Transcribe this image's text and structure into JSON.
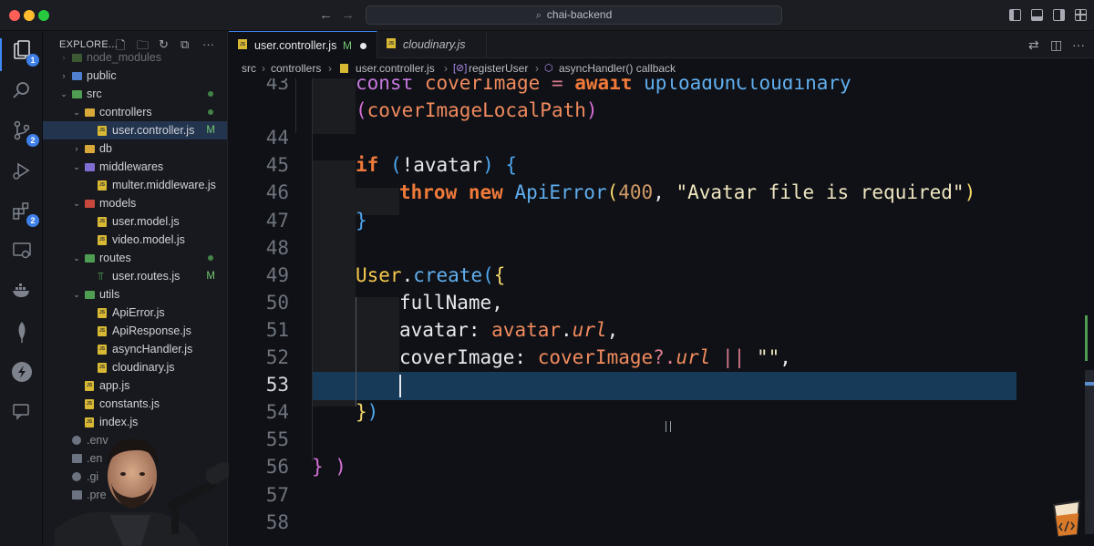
{
  "window": {
    "title": "chai-backend"
  },
  "activity_bar": {
    "explorer_badge": "1",
    "scm_badge": "2",
    "extensions_badge": "2"
  },
  "explorer": {
    "title": "EXPLORE...",
    "items": [
      {
        "label": "node_modules",
        "type": "folder",
        "depth": 1
      },
      {
        "label": "public",
        "type": "folder",
        "depth": 1
      },
      {
        "label": "src",
        "type": "folder-open",
        "depth": 1
      },
      {
        "label": "controllers",
        "type": "folder-open",
        "depth": 2
      },
      {
        "label": "user.controller.js",
        "type": "file",
        "depth": 3,
        "status": "M"
      },
      {
        "label": "db",
        "type": "folder",
        "depth": 2
      },
      {
        "label": "middlewares",
        "type": "folder-open",
        "depth": 2
      },
      {
        "label": "multer.middleware.js",
        "type": "file",
        "depth": 3
      },
      {
        "label": "models",
        "type": "folder-open",
        "depth": 2
      },
      {
        "label": "user.model.js",
        "type": "file",
        "depth": 3
      },
      {
        "label": "video.model.js",
        "type": "file",
        "depth": 3
      },
      {
        "label": "routes",
        "type": "folder-open",
        "depth": 2
      },
      {
        "label": "user.routes.js",
        "type": "file",
        "depth": 3,
        "status": "M"
      },
      {
        "label": "utils",
        "type": "folder-open",
        "depth": 2
      },
      {
        "label": "ApiError.js",
        "type": "file",
        "depth": 3
      },
      {
        "label": "ApiResponse.js",
        "type": "file",
        "depth": 3
      },
      {
        "label": "asyncHandler.js",
        "type": "file",
        "depth": 3
      },
      {
        "label": "cloudinary.js",
        "type": "file",
        "depth": 3
      },
      {
        "label": "app.js",
        "type": "file",
        "depth": 2
      },
      {
        "label": "constants.js",
        "type": "file",
        "depth": 2
      },
      {
        "label": "index.js",
        "type": "file",
        "depth": 2
      },
      {
        "label": ".env",
        "type": "config",
        "depth": 1
      },
      {
        "label": ".en",
        "type": "config",
        "depth": 1
      },
      {
        "label": ".gi",
        "type": "config",
        "depth": 1
      },
      {
        "label": ".pre",
        "type": "config",
        "depth": 1
      }
    ]
  },
  "tabs": [
    {
      "label": "user.controller.js",
      "status": "M",
      "dirty": true,
      "active": true
    },
    {
      "label": "cloudinary.js",
      "active": false
    }
  ],
  "breadcrumb": {
    "parts": [
      "src",
      "controllers",
      "user.controller.js",
      "registerUser",
      "asyncHandler() callback"
    ]
  },
  "editor": {
    "current_line": "53",
    "lines": [
      {
        "no": "43",
        "tokens": [
          [
            "kw2",
            "const "
          ],
          [
            "obj",
            "coverImage"
          ],
          [
            "op",
            " = "
          ],
          [
            "kw",
            "await "
          ],
          [
            "fn",
            "uploadOnCloudinary"
          ]
        ]
      },
      {
        "no": "",
        "tokens": [
          [
            "brace-p",
            "("
          ],
          [
            "obj",
            "coverImageLocalPath"
          ],
          [
            "brace-p",
            ")"
          ]
        ]
      },
      {
        "no": "44",
        "tokens": []
      },
      {
        "no": "45",
        "tokens": [
          [
            "kw",
            "if "
          ],
          [
            "brace-b",
            "("
          ],
          [
            "prop",
            "!avatar"
          ],
          [
            "brace-b",
            ")"
          ],
          [
            "prop",
            " "
          ],
          [
            "brace-b",
            "{"
          ]
        ]
      },
      {
        "no": "46",
        "tokens": [
          [
            "kw",
            "throw "
          ],
          [
            "kw",
            "new "
          ],
          [
            "fn",
            "ApiError"
          ],
          [
            "brace-y",
            "("
          ],
          [
            "num",
            "400"
          ],
          [
            "prop",
            ", "
          ],
          [
            "str",
            "\"Avatar file is required\""
          ],
          [
            "brace-y",
            ")"
          ]
        ]
      },
      {
        "no": "47",
        "tokens": [
          [
            "brace-b",
            "}"
          ]
        ]
      },
      {
        "no": "48",
        "tokens": []
      },
      {
        "no": "49",
        "tokens": [
          [
            "cls",
            "User"
          ],
          [
            "prop",
            "."
          ],
          [
            "fn",
            "create"
          ],
          [
            "brace-b",
            "("
          ],
          [
            "brace-y",
            "{"
          ]
        ]
      },
      {
        "no": "50",
        "tokens": [
          [
            "prop",
            "fullName,"
          ]
        ]
      },
      {
        "no": "51",
        "tokens": [
          [
            "prop",
            "avatar: "
          ],
          [
            "obj",
            "avatar"
          ],
          [
            "prop",
            "."
          ],
          [
            "ital",
            "url"
          ],
          [
            "prop",
            ","
          ]
        ]
      },
      {
        "no": "52",
        "tokens": [
          [
            "prop",
            "coverImage: "
          ],
          [
            "obj",
            "coverImage"
          ],
          [
            "op",
            "?."
          ],
          [
            "ital",
            "url"
          ],
          [
            "op",
            " || "
          ],
          [
            "str",
            "\"\""
          ],
          [
            "prop",
            ","
          ]
        ]
      },
      {
        "no": "53",
        "tokens": []
      },
      {
        "no": "54",
        "tokens": [
          [
            "brace-y",
            "}"
          ],
          [
            "brace-b",
            ")"
          ]
        ]
      },
      {
        "no": "55",
        "tokens": []
      },
      {
        "no": "56",
        "tokens": [
          [
            "brace-p",
            "} "
          ],
          [
            "brace-p",
            ")"
          ]
        ]
      },
      {
        "no": "57",
        "tokens": []
      },
      {
        "no": "58",
        "tokens": []
      }
    ]
  },
  "colors": {
    "accent": "#3f88f6",
    "keyword": "#f07a3a",
    "function": "#61aeee",
    "modified": "#72c76e"
  }
}
